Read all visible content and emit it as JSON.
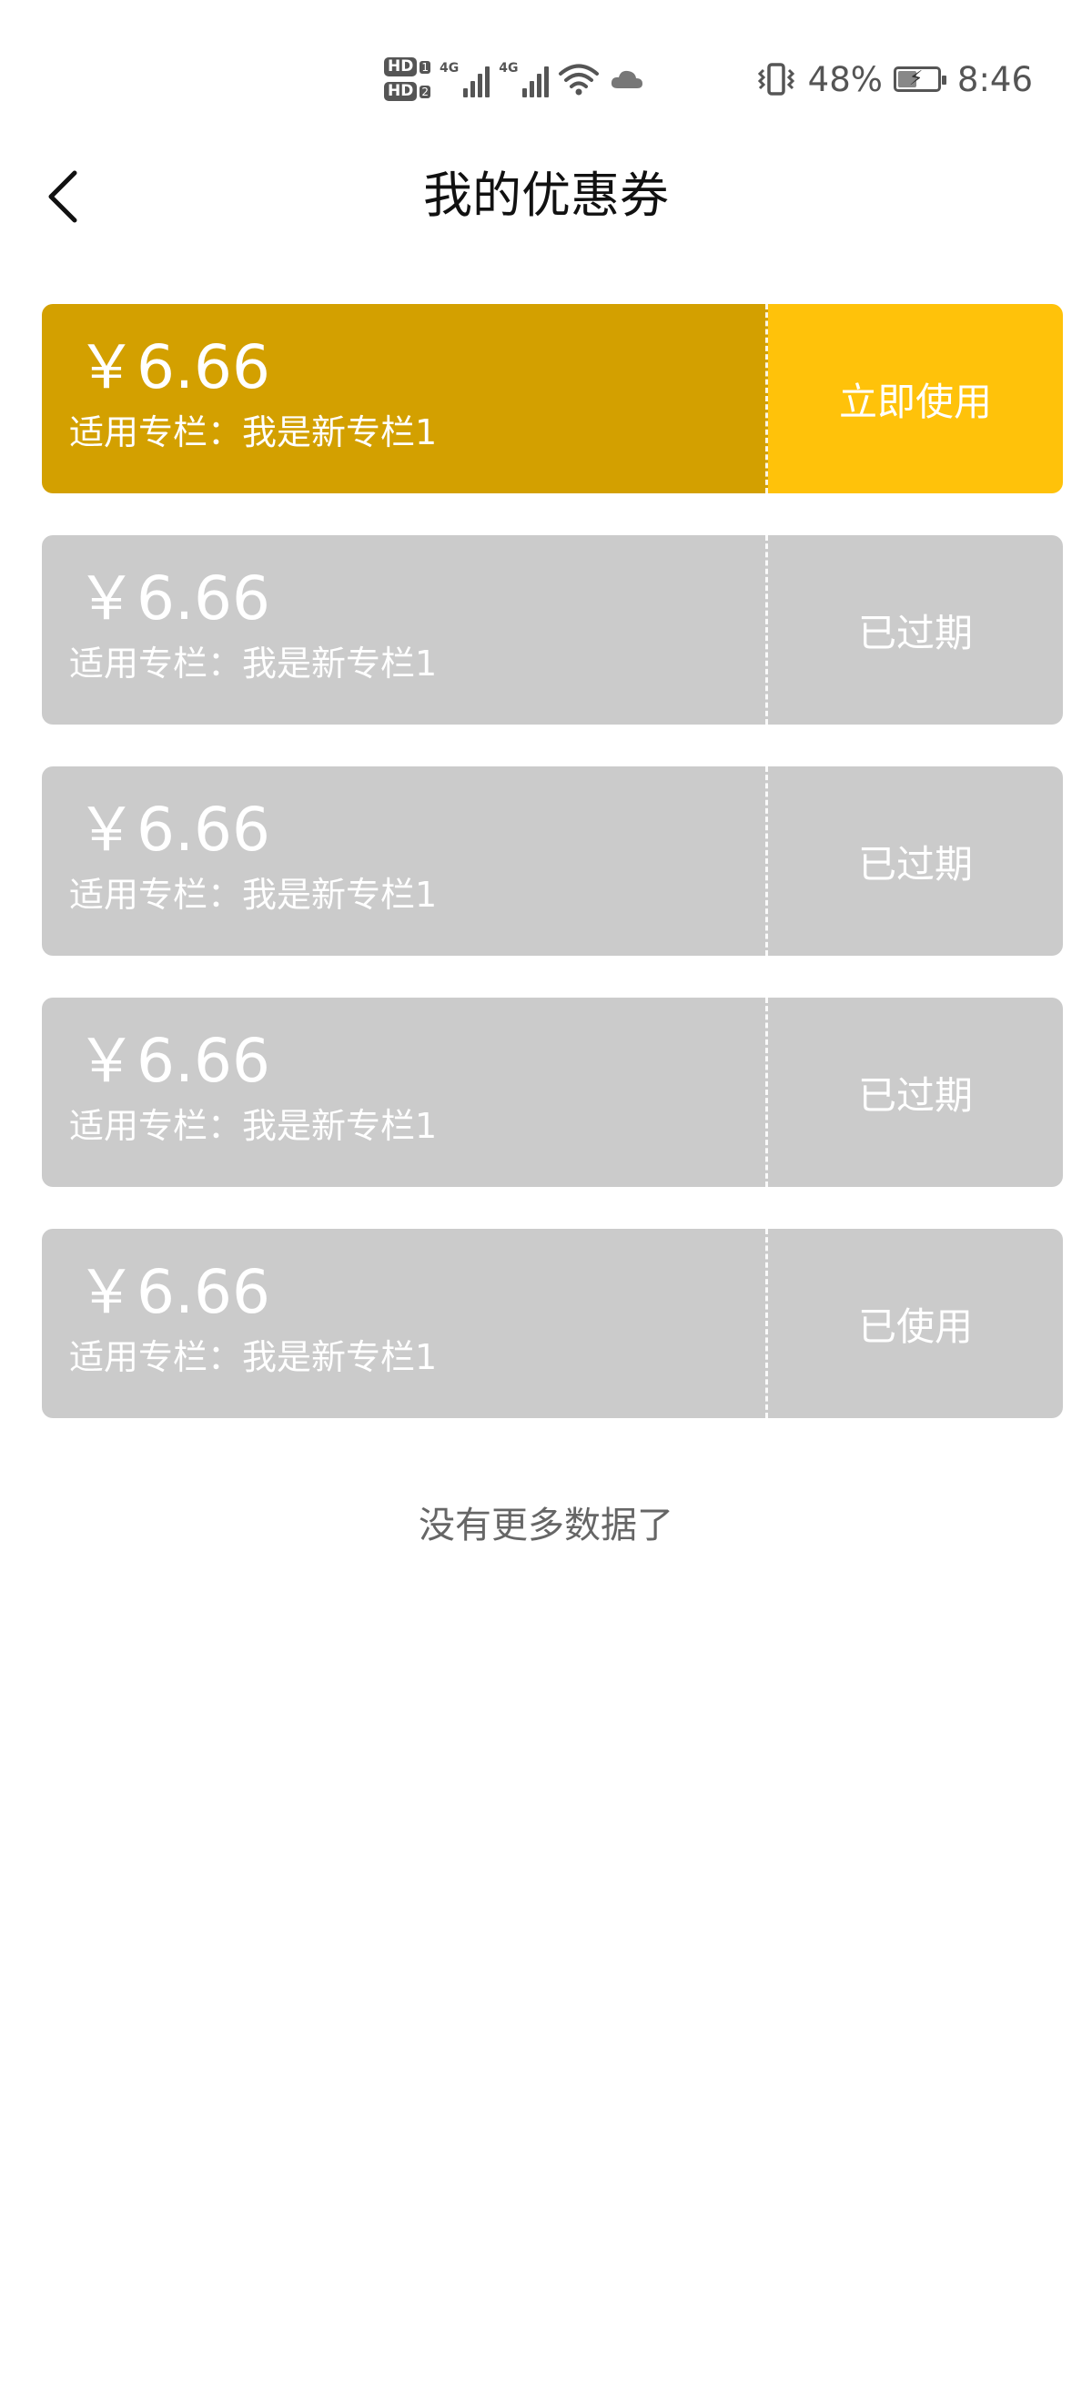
{
  "status_bar": {
    "sim1_label": "HD",
    "sim1_num": "1",
    "sim2_label": "HD",
    "sim2_num": "2",
    "network1": "4G",
    "network2": "4G",
    "battery_percent": "48%",
    "battery_level": 0.48,
    "time": "8:46",
    "icons": [
      "vibrate-icon",
      "wifi-icon",
      "cloud-icon",
      "battery-icon",
      "signal-icon"
    ]
  },
  "header": {
    "title": "我的优惠券",
    "back_icon": "chevron-left-icon"
  },
  "coupons": [
    {
      "amount": "￥6.66",
      "scope": "适用专栏：我是新专栏1",
      "action": "立即使用",
      "state": "active"
    },
    {
      "amount": "￥6.66",
      "scope": "适用专栏：我是新专栏1",
      "action": "已过期",
      "state": "expired"
    },
    {
      "amount": "￥6.66",
      "scope": "适用专栏：我是新专栏1",
      "action": "已过期",
      "state": "expired"
    },
    {
      "amount": "￥6.66",
      "scope": "适用专栏：我是新专栏1",
      "action": "已过期",
      "state": "expired"
    },
    {
      "amount": "￥6.66",
      "scope": "适用专栏：我是新专栏1",
      "action": "已使用",
      "state": "used"
    }
  ],
  "footer": {
    "no_more": "没有更多数据了"
  },
  "colors": {
    "active_left": "#d3a000",
    "active_right": "#ffc20a",
    "inactive": "#cbcbcb"
  }
}
